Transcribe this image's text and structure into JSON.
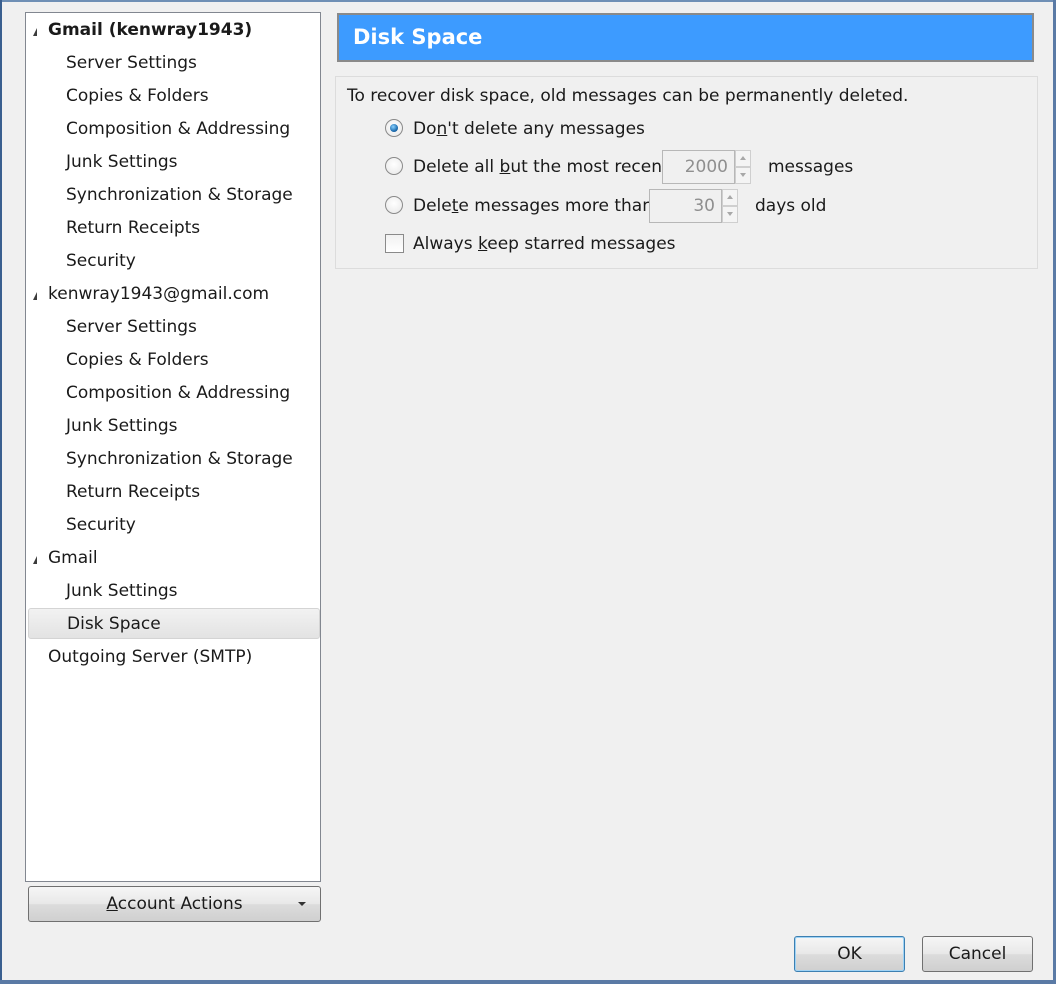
{
  "tree": {
    "accounts": [
      {
        "label": "Gmail (kenwray1943)",
        "items": [
          "Server Settings",
          "Copies & Folders",
          "Composition & Addressing",
          "Junk Settings",
          "Synchronization & Storage",
          "Return Receipts",
          "Security"
        ]
      },
      {
        "label": "kenwray1943@gmail.com",
        "items": [
          "Server Settings",
          "Copies & Folders",
          "Composition & Addressing",
          "Junk Settings",
          "Synchronization & Storage",
          "Return Receipts",
          "Security"
        ]
      },
      {
        "label": "Gmail",
        "items": [
          "Junk Settings",
          "Disk Space"
        ]
      }
    ],
    "outgoing": "Outgoing Server (SMTP)"
  },
  "account_actions": {
    "pre": "",
    "u": "A",
    "post": "ccount Actions"
  },
  "panel": {
    "title": "Disk Space",
    "description": "To recover disk space, old messages can be permanently deleted.",
    "opt_none": {
      "pre": "Do",
      "u": "n",
      "post": "'t delete any messages"
    },
    "opt_recent": {
      "pre": "Delete all ",
      "u": "b",
      "post": "ut the most recent",
      "value": "2000",
      "suffix": "messages"
    },
    "opt_days": {
      "pre": "Dele",
      "u": "t",
      "post": "e messages more than",
      "value": "30",
      "suffix": "days old"
    },
    "opt_starred": {
      "pre": "Always ",
      "u": "k",
      "post": "eep starred messages"
    }
  },
  "buttons": {
    "ok": "OK",
    "cancel": "Cancel"
  }
}
